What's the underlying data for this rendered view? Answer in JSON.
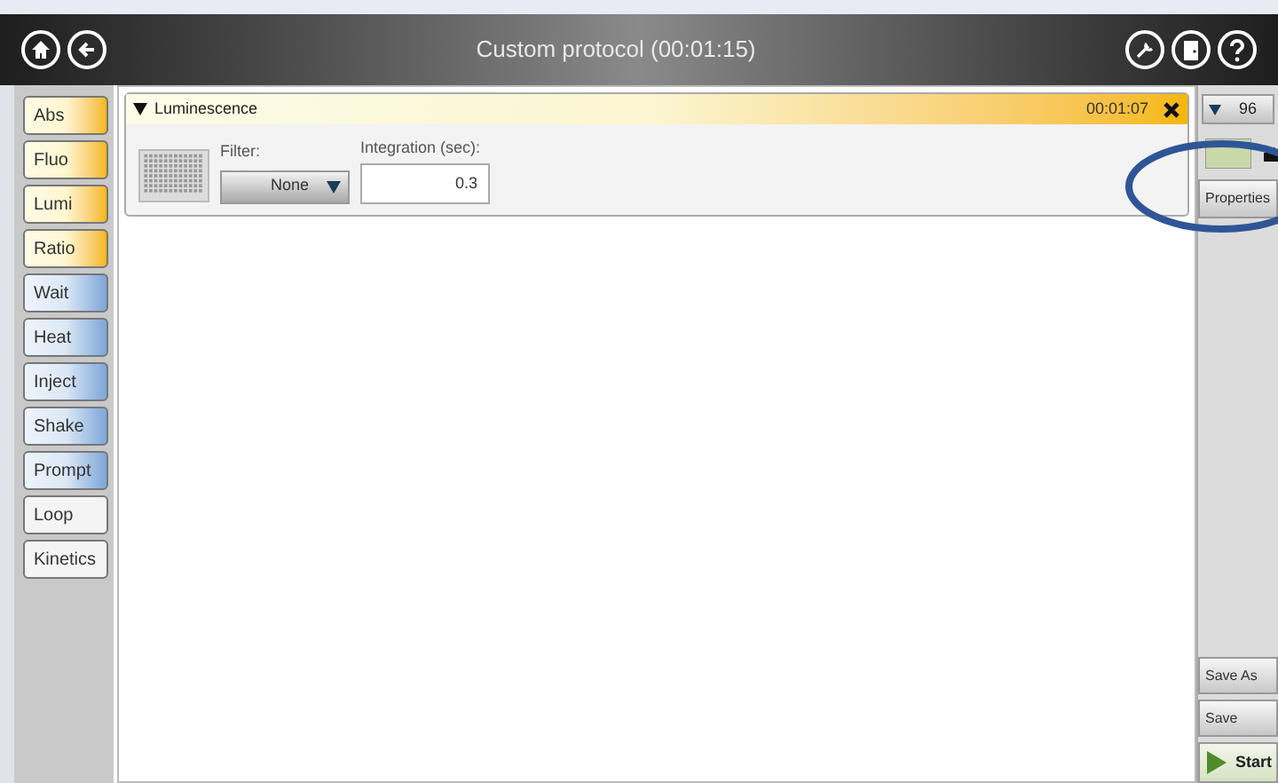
{
  "window": {
    "title": "Custom protocol (00:01:15)"
  },
  "sidebar": {
    "items": [
      {
        "label": "Abs",
        "kind": "measure"
      },
      {
        "label": "Fluo",
        "kind": "measure"
      },
      {
        "label": "Lumi",
        "kind": "measure"
      },
      {
        "label": "Ratio",
        "kind": "measure"
      },
      {
        "label": "Wait",
        "kind": "action"
      },
      {
        "label": "Heat",
        "kind": "action"
      },
      {
        "label": "Inject",
        "kind": "action"
      },
      {
        "label": "Shake",
        "kind": "action"
      },
      {
        "label": "Prompt",
        "kind": "action"
      },
      {
        "label": "Loop",
        "kind": "control"
      },
      {
        "label": "Kinetics",
        "kind": "control"
      }
    ]
  },
  "steps": [
    {
      "title": "Luminescence",
      "expanded": true,
      "duration": "00:01:07",
      "filter": {
        "label": "Filter:",
        "value": "None"
      },
      "integration": {
        "label": "Integration (sec):",
        "value": "0.3"
      }
    }
  ],
  "right_panel": {
    "plate": "96",
    "buttons": [
      "Properties"
    ],
    "bottom_buttons": [
      "Save As",
      "Save"
    ],
    "start": "Start"
  }
}
